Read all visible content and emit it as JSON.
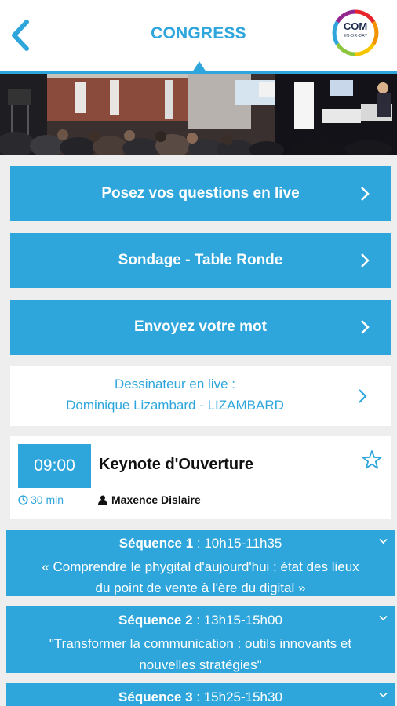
{
  "header": {
    "title": "CONGRESS",
    "back_icon": "chevron-left-icon",
    "logo_text": "COM",
    "logo_sub": "EN-OR-DAY",
    "accent": "#2ea6dc"
  },
  "actions": [
    {
      "label": "Posez vos questions en live",
      "icon": "chevron-right-icon"
    },
    {
      "label": "Sondage - Table Ronde",
      "icon": "chevron-right-icon"
    },
    {
      "label": "Envoyez votre mot",
      "icon": "chevron-right-icon"
    }
  ],
  "live_drawer": {
    "line1": "Dessinateur en live :",
    "line2": "Dominique Lizambard - LIZAMBARD",
    "icon": "chevron-right-icon"
  },
  "keynote": {
    "time": "09:00",
    "title": "Keynote d'Ouverture",
    "duration": "30 min",
    "speaker": "Maxence Dislaire",
    "favorite_icon": "star-outline-icon"
  },
  "sequences": [
    {
      "label": "Séquence 1",
      "time": " : 10h15-11h35",
      "desc1": "« Comprendre le phygital d'aujourd'hui : état des lieux",
      "desc2": "du point de vente à l'ère du digital »"
    },
    {
      "label": "Séquence 2",
      "time": " : 13h15-15h00",
      "desc1": "\"Transformer la communication : outils innovants et",
      "desc2": "nouvelles stratégies\""
    },
    {
      "label": "Séquence 3",
      "time": " : 15h25-15h30",
      "desc1": "",
      "desc2": ""
    }
  ]
}
